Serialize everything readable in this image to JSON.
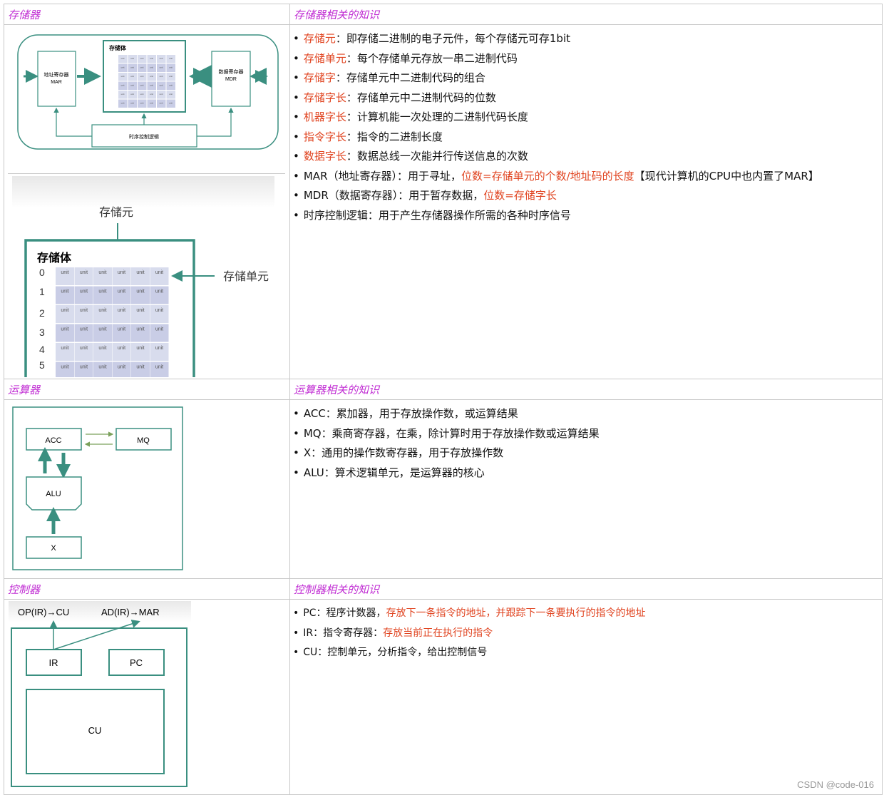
{
  "sections": [
    {
      "left_header": "存储器",
      "right_header": "存储器相关的知识",
      "notes": [
        {
          "term": "存储元",
          "text": "：即存储二进制的电子元件，每个存储元可存1bit"
        },
        {
          "term": "存储单元",
          "text": "：每个存储单元存放一串二进制代码"
        },
        {
          "term": "存储字",
          "text": "：存储单元中二进制代码的组合"
        },
        {
          "term": "存储字长",
          "text": "：存储单元中二进制代码的位数"
        },
        {
          "term": "机器字长",
          "text": "：计算机能一次处理的二进制代码长度"
        },
        {
          "term": "指令字长",
          "text": "：指令的二进制长度"
        },
        {
          "term": "数据字长",
          "text": "：数据总线一次能并行传送信息的次数"
        }
      ],
      "mar_note": {
        "pre": "MAR（地址寄存器）：用于寻址，",
        "red": "位数=存储单元的个数/地址码的长度",
        "post": "【现代计算机的CPU中也内置了MAR】"
      },
      "mdr_note": {
        "pre": "MDR（数据寄存器）：用于暂存数据，",
        "red": "位数=存储字长"
      },
      "timing_note": "时序控制逻辑：用于产生存储器操作所需的各种时序信号"
    },
    {
      "left_header": "运算器",
      "right_header": "运算器相关的知识",
      "notes": [
        "ACC：累加器，用于存放操作数，或运算结果",
        "MQ：乘商寄存器，在乘，除计算时用于存放操作数或运算结果",
        "X：通用的操作数寄存器，用于存放操作数",
        "ALU：算术逻辑单元，是运算器的核心"
      ]
    },
    {
      "left_header": "控制器",
      "right_header": "控制器相关的知识",
      "notes": [
        {
          "pre": "PC：程序计数器，",
          "red": "存放下一条指令的地址，并跟踪下一条要执行的指令的地址"
        },
        {
          "pre": "IR：指令寄存器：",
          "red": "存放当前正在执行的指令"
        },
        {
          "pre": "CU：控制单元，分析指令，给出控制信号",
          "red": ""
        }
      ]
    }
  ],
  "diagram1": {
    "mar_label_1": "地址寄存器",
    "mar_label_2": "MAR",
    "body_title": "存储体",
    "mdr_label_1": "数据寄存器",
    "mdr_label_2": "MDR",
    "timing_label": "时序控制逻辑",
    "cell_text": "unit"
  },
  "diagram2": {
    "cell_label": "存储元",
    "body_title": "存储体",
    "unit_label": "存储单元",
    "rows": [
      "0",
      "1",
      "2",
      "3",
      "4",
      "5"
    ],
    "cell_text": "unit"
  },
  "alu_diagram": {
    "acc": "ACC",
    "mq": "MQ",
    "alu": "ALU",
    "x": "X"
  },
  "cu_diagram": {
    "op_label": "OP(IR)→CU",
    "ad_label": "AD(IR)→MAR",
    "ir": "IR",
    "pc": "PC",
    "cu": "CU"
  },
  "watermark": "CSDN @code-016",
  "colors": {
    "header": "#c02cd3",
    "highlight": "#e0431f",
    "diagram": "#3a8f80",
    "cell": "#d8dced",
    "cell_alt": "#c9cde6"
  }
}
